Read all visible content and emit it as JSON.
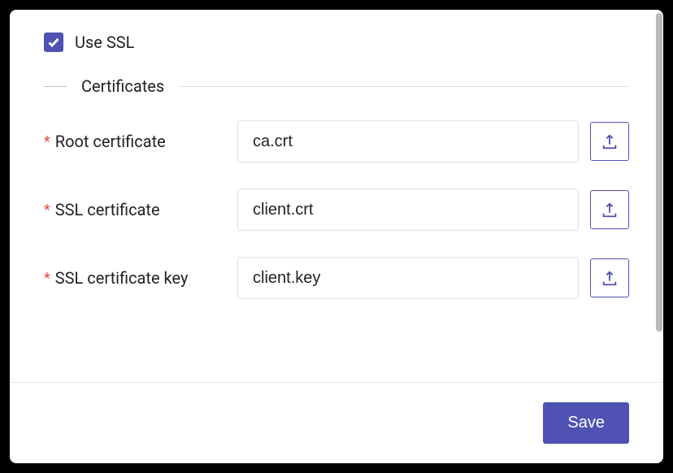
{
  "ssl": {
    "checkbox_label": "Use SSL",
    "checked": true
  },
  "section": {
    "title": "Certificates"
  },
  "fields": {
    "root_cert": {
      "label": "Root certificate",
      "value": "ca.crt",
      "required": true
    },
    "ssl_cert": {
      "label": "SSL certificate",
      "value": "client.crt",
      "required": true
    },
    "ssl_key": {
      "label": "SSL certificate key",
      "value": "client.key",
      "required": true
    }
  },
  "footer": {
    "save_label": "Save"
  }
}
